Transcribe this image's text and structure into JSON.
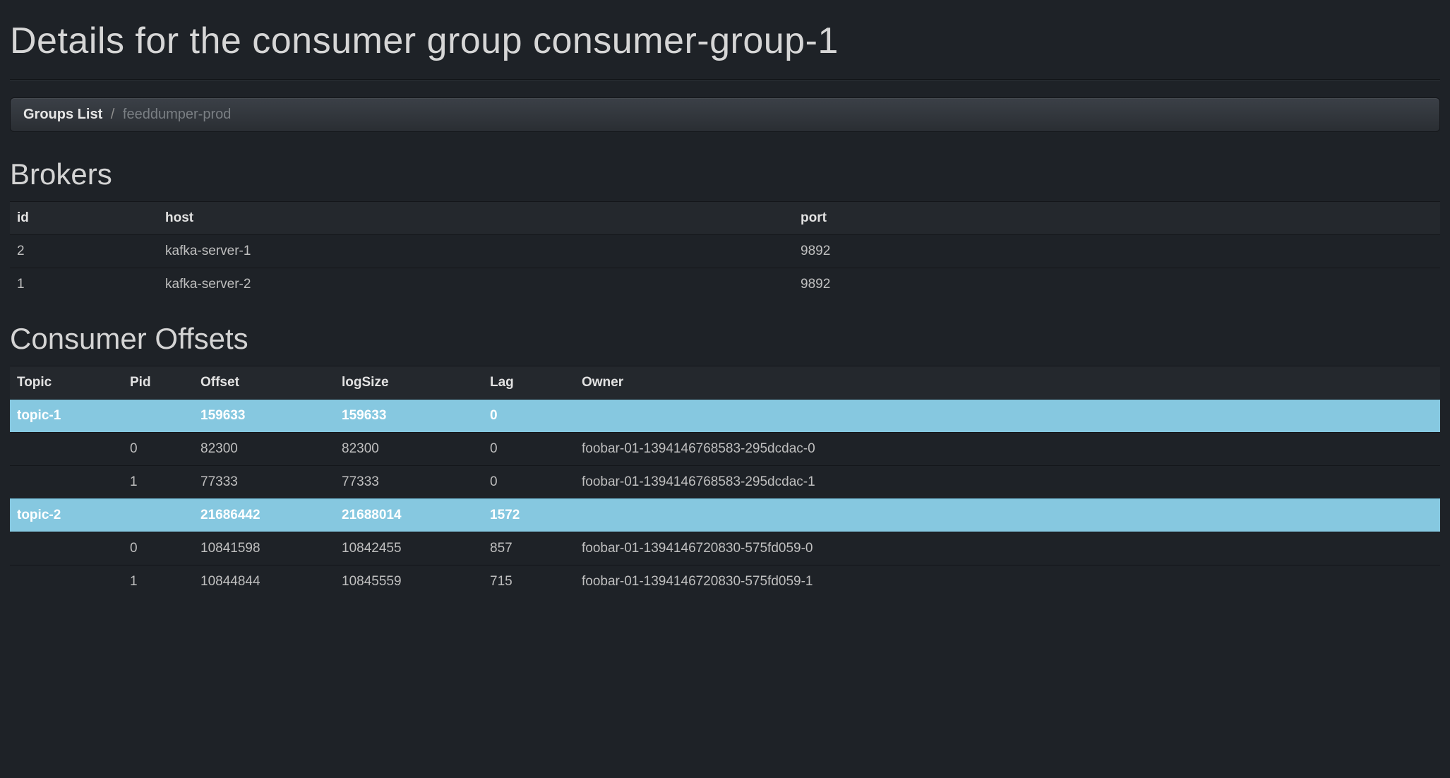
{
  "page_title": "Details for the consumer group consumer-group-1",
  "breadcrumb": {
    "root": "Groups List",
    "separator": "/",
    "current": "feeddumper-prod"
  },
  "brokers": {
    "heading": "Brokers",
    "columns": {
      "id": "id",
      "host": "host",
      "port": "port"
    },
    "rows": [
      {
        "id": "2",
        "host": "kafka-server-1",
        "port": "9892"
      },
      {
        "id": "1",
        "host": "kafka-server-2",
        "port": "9892"
      }
    ]
  },
  "offsets": {
    "heading": "Consumer Offsets",
    "columns": {
      "topic": "Topic",
      "pid": "Pid",
      "offset": "Offset",
      "logSize": "logSize",
      "lag": "Lag",
      "owner": "Owner"
    },
    "rows": [
      {
        "highlight": true,
        "topic": "topic-1",
        "pid": "",
        "offset": "159633",
        "logSize": "159633",
        "lag": "0",
        "owner": ""
      },
      {
        "highlight": false,
        "topic": "",
        "pid": "0",
        "offset": "82300",
        "logSize": "82300",
        "lag": "0",
        "owner": "foobar-01-1394146768583-295dcdac-0"
      },
      {
        "highlight": false,
        "topic": "",
        "pid": "1",
        "offset": "77333",
        "logSize": "77333",
        "lag": "0",
        "owner": "foobar-01-1394146768583-295dcdac-1"
      },
      {
        "highlight": true,
        "topic": "topic-2",
        "pid": "",
        "offset": "21686442",
        "logSize": "21688014",
        "lag": "1572",
        "owner": ""
      },
      {
        "highlight": false,
        "topic": "",
        "pid": "0",
        "offset": "10841598",
        "logSize": "10842455",
        "lag": "857",
        "owner": "foobar-01-1394146720830-575fd059-0"
      },
      {
        "highlight": false,
        "topic": "",
        "pid": "1",
        "offset": "10844844",
        "logSize": "10845559",
        "lag": "715",
        "owner": "foobar-01-1394146720830-575fd059-1"
      }
    ]
  }
}
